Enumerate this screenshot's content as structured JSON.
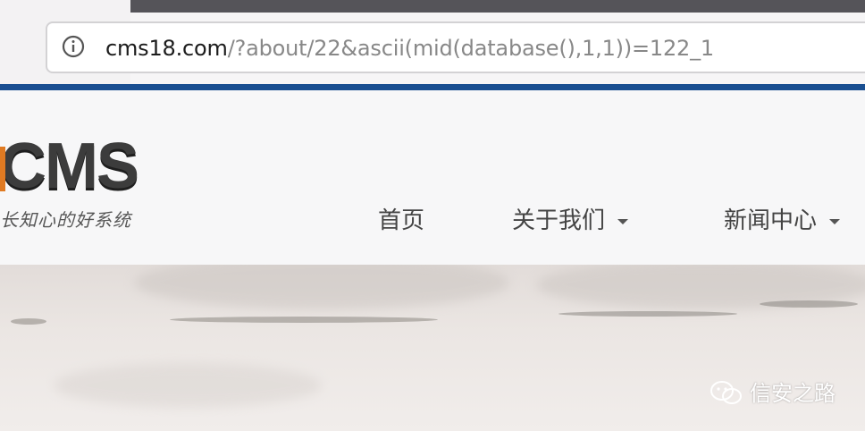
{
  "browser": {
    "url_host": "cms18.com",
    "url_path": "/?about/22&ascii(mid(database(),1,1))=122_1",
    "info_icon": "info-icon"
  },
  "site": {
    "logo_text": "CMS",
    "slogan": "长知心的好系统",
    "nav": [
      {
        "label": "首页",
        "has_dropdown": false
      },
      {
        "label": "关于我们",
        "has_dropdown": true
      },
      {
        "label": "新闻中心",
        "has_dropdown": true
      }
    ]
  },
  "watermark": {
    "icon": "wechat-icon",
    "text": "信安之路"
  },
  "colors": {
    "accent_line": "#1a4f91",
    "logo_accent": "#e07a22"
  }
}
